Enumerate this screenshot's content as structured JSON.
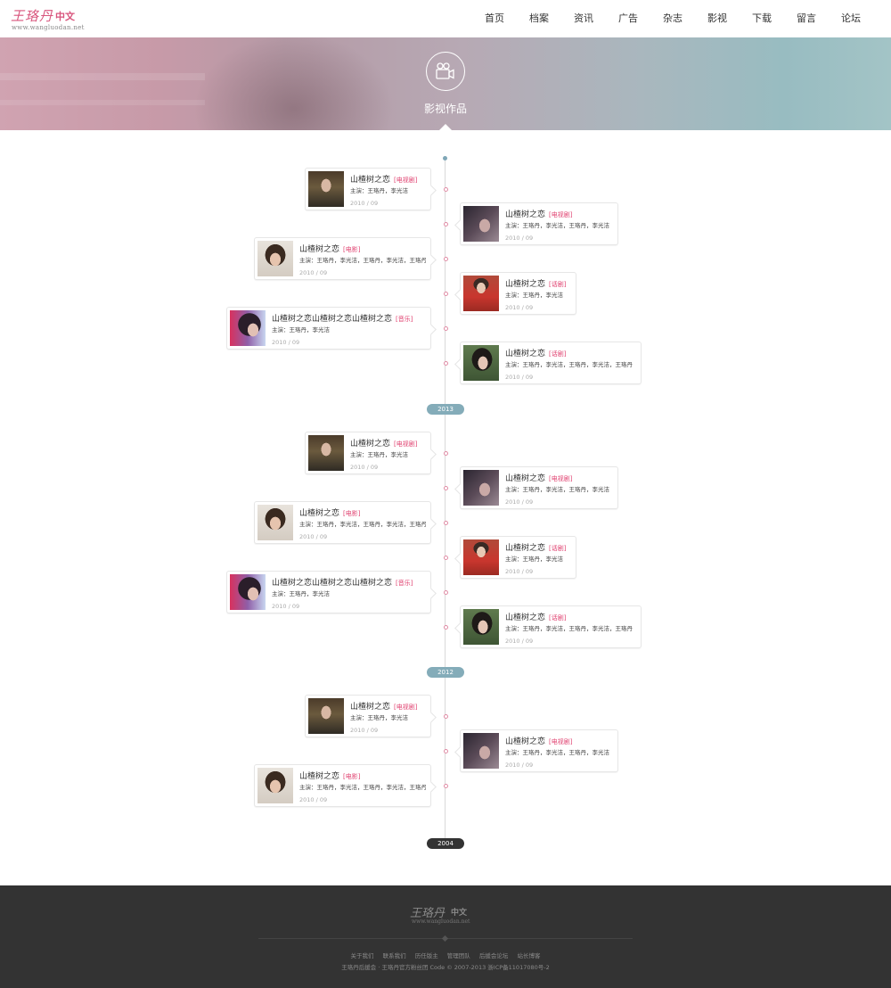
{
  "logo": {
    "script": "王珞丹",
    "cn": "中文",
    "url": "www.wangluodan.net"
  },
  "nav": [
    "首页",
    "档案",
    "资讯",
    "广告",
    "杂志",
    "影视",
    "下载",
    "留言",
    "论坛"
  ],
  "banner": {
    "title": "影视作品",
    "icon": "video-camera-icon"
  },
  "years": [
    "2013",
    "2012",
    "2004"
  ],
  "cards": [
    {
      "title": "山楂树之恋",
      "tag": "[电视剧]",
      "actors": "主演：王珞丹，李光洁",
      "date": "2010 / 09"
    },
    {
      "title": "山楂树之恋",
      "tag": "[电视剧]",
      "actors": "主演：王珞丹，李光洁，王珞丹，李光洁",
      "date": "2010 / 09"
    },
    {
      "title": "山楂树之恋",
      "tag": "[电影]",
      "actors": "主演：王珞丹，李光洁，王珞丹，李光洁，王珞丹",
      "date": "2010 / 09"
    },
    {
      "title": "山楂树之恋",
      "tag": "[话剧]",
      "actors": "主演：王珞丹，李光洁",
      "date": "2010 / 09"
    },
    {
      "title": "山楂树之恋山楂树之恋山楂树之恋",
      "tag": "[音乐]",
      "actors": "主演：王珞丹，李光洁",
      "date": "2010 / 09"
    },
    {
      "title": "山楂树之恋",
      "tag": "[话剧]",
      "actors": "主演：王珞丹，李光洁，王珞丹，李光洁，王珞丹",
      "date": "2010 / 09"
    },
    {
      "title": "山楂树之恋",
      "tag": "[电视剧]",
      "actors": "主演：王珞丹，李光洁",
      "date": "2010 / 09"
    },
    {
      "title": "山楂树之恋",
      "tag": "[电视剧]",
      "actors": "主演：王珞丹，李光洁，王珞丹，李光洁",
      "date": "2010 / 09"
    },
    {
      "title": "山楂树之恋",
      "tag": "[电影]",
      "actors": "主演：王珞丹，李光洁，王珞丹，李光洁，王珞丹",
      "date": "2010 / 09"
    },
    {
      "title": "山楂树之恋",
      "tag": "[话剧]",
      "actors": "主演：王珞丹，李光洁",
      "date": "2010 / 09"
    },
    {
      "title": "山楂树之恋山楂树之恋山楂树之恋",
      "tag": "[音乐]",
      "actors": "主演：王珞丹，李光洁",
      "date": "2010 / 09"
    },
    {
      "title": "山楂树之恋",
      "tag": "[话剧]",
      "actors": "主演：王珞丹，李光洁，王珞丹，李光洁，王珞丹",
      "date": "2010 / 09"
    },
    {
      "title": "山楂树之恋",
      "tag": "[电视剧]",
      "actors": "主演：王珞丹，李光洁",
      "date": "2010 / 09"
    },
    {
      "title": "山楂树之恋",
      "tag": "[电视剧]",
      "actors": "主演：王珞丹，李光洁，王珞丹，李光洁",
      "date": "2010 / 09"
    },
    {
      "title": "山楂树之恋",
      "tag": "[电影]",
      "actors": "主演：王珞丹，李光洁，王珞丹，李光洁，王珞丹",
      "date": "2010 / 09"
    }
  ],
  "footer": {
    "logo": {
      "script": "王珞丹",
      "cn": "中文",
      "url": "www.wangluodan.net"
    },
    "links": [
      "关于我们",
      "联系我们",
      "历任版主",
      "管理团队",
      "后援会论坛",
      "站长博客"
    ],
    "copyright": "王珞丹后援会 · 王珞丹官方粉丝团 Code © 2007-2013 浙ICP备11017080号-2"
  }
}
